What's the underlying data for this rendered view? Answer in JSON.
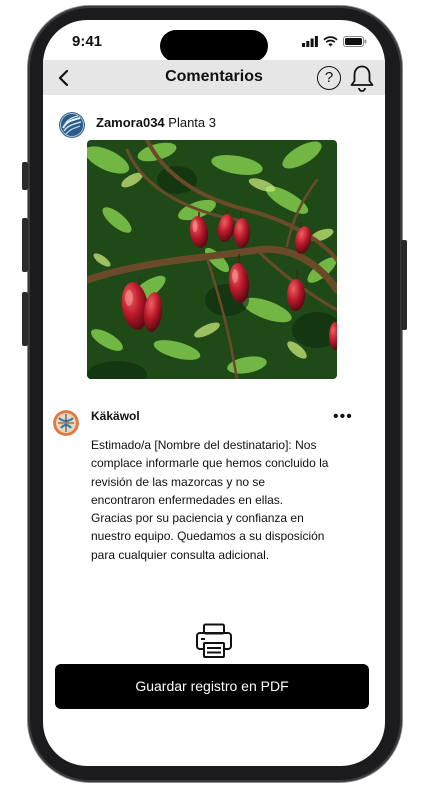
{
  "status_bar": {
    "time": "9:41"
  },
  "header": {
    "title": "Comentarios",
    "help_label": "?"
  },
  "post": {
    "username": "Zamora034",
    "subtitle": "Planta 3"
  },
  "comment": {
    "author": "Käkäwol",
    "more_label": "•••",
    "text": "Estimado/a [Nombre del  destinatario]:   Nos\ncomplace informarle que  hemos concluido la\nrevisión de las  mazorcas y no se\nencontraron  enfermedades en ellas.\nGracias por su paciencia y  confianza en\nnuestro equipo.  Quedamos a su disposición\npara  cualquier consulta adicional."
  },
  "actions": {
    "save_pdf_label": "Guardar registro en PDF"
  }
}
